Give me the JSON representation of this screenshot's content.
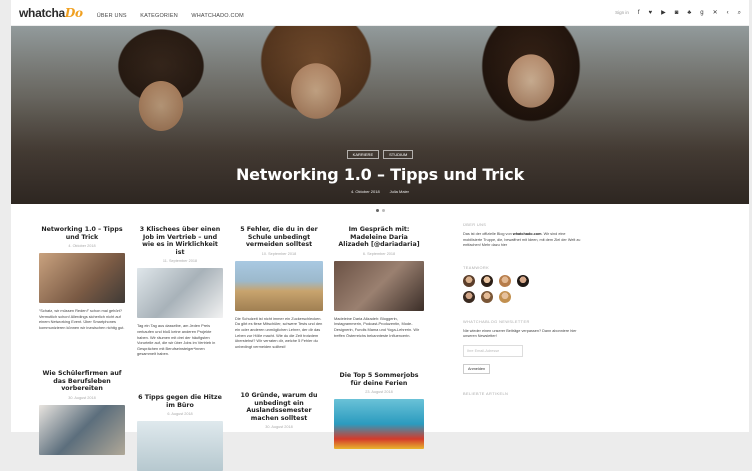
{
  "header": {
    "logo_text": "whatcha",
    "logo_accent": "Do",
    "nav": [
      "ÜBER UNS",
      "KATEGORIEN",
      "WHATCHADO.COM"
    ],
    "signin": "Sign in",
    "social_icons": [
      "facebook-icon",
      "twitter-icon",
      "youtube-icon",
      "instagram-icon",
      "snapchat-icon",
      "googleplus-icon",
      "xing-icon",
      "share-icon",
      "search-icon"
    ]
  },
  "hero": {
    "tags": [
      "KARRIERE",
      "STUDIUM"
    ],
    "title": "Networking 1.0 – Tipps und Trick",
    "date": "4. Oktober 2018",
    "author": "Julia Maier"
  },
  "slider": {
    "count": 2,
    "active": 0
  },
  "posts": [
    {
      "title": "Networking 1.0 – Tipps und Trick",
      "date": "4. Oktober 2018",
      "excerpt": "“Schatz, wir müssen Reden!” schon mal gehört? Vermutlich schon! Allerdings sicherlich nicht auf einem Networking Event. Über Smartphones kommunizieren können wir inzwischen richtig gut."
    },
    {
      "title": "3 Klischees über einen Job im Vertrieb – und wie es in Wirklichkeit ist",
      "date": "11. September 2018",
      "excerpt": "Tag ein Tag aus dasselbe, am Jeden Preis verkaufen und bloß keine anderen Projekte haben. Wir räumen mit drei der häufigsten Vorurteile auf, die wir über Jobs im Vertrieb in Gesprächen mit Berufseinsteiger*innen gesammelt haben."
    },
    {
      "title": "5 Fehler, die du in der Schule unbedingt vermeiden solltest",
      "date": "10. September 2018",
      "excerpt": "Die Schulzeit ist nicht immer ein Zuckerschlecken. Da gibt es fiese Mitschüler, schwere Tests und den ein oder anderen unmöglichen Lehrer, der dir das Leben zur Hölle macht. Wie du die Zeit trotzdem überstehst? Wir verraten dir, welche 5 Fehler du unbedingt vermeiden solltest!"
    },
    {
      "title": "Im Gespräch mit: Madeleine Daria Alizadeh [@dariadaria]",
      "date": "6. September 2018",
      "excerpt": "Madeleine Daria Alizadeh: Bloggerin, Instagrammerin, Podcast-Produzentin, Mode-Designerin, Fundis Mama und Yoga-Lehrerin. Wir treffen Österreichs bekannteste Influencerin."
    },
    {
      "title": "Wie Schülerfirmen auf das Berufsleben vorbereiten",
      "date": "30. August 2018"
    },
    {
      "title": "6 Tipps gegen die Hitze im Büro",
      "date": "6. August 2018"
    },
    {
      "title": "10 Gründe, warum du unbedingt ein Auslandssemester machen solltest",
      "date": "30. August 2018"
    },
    {
      "title": "Die Top 5 Sommerjobs für deine Ferien",
      "date": "23. August 2018"
    }
  ],
  "sidebar": {
    "about_heading": "ÜBER UNS",
    "about_text_pre": "Das ist der offizielle Blog von ",
    "about_link": "whatchado.com",
    "about_text_post": ". Wir sind eine mobilisierte Truppe, die, bewaffnet mit Ideen, mit dem Ziel der Welt zu entfachen! Mehr dazu hier",
    "team_heading": "TEAMWORK",
    "newsletter_heading": "WHATCHABLOG NEWSLETTER",
    "newsletter_text": "Nie wieder einen unserer Beiträge verpassen? Dann abonniere hier unseren Newsletter!",
    "email_placeholder": "Ihre Email-Adresse",
    "subscribe_label": "Anmelden",
    "popular_heading": "BELIEBTE ARTIKELN"
  }
}
